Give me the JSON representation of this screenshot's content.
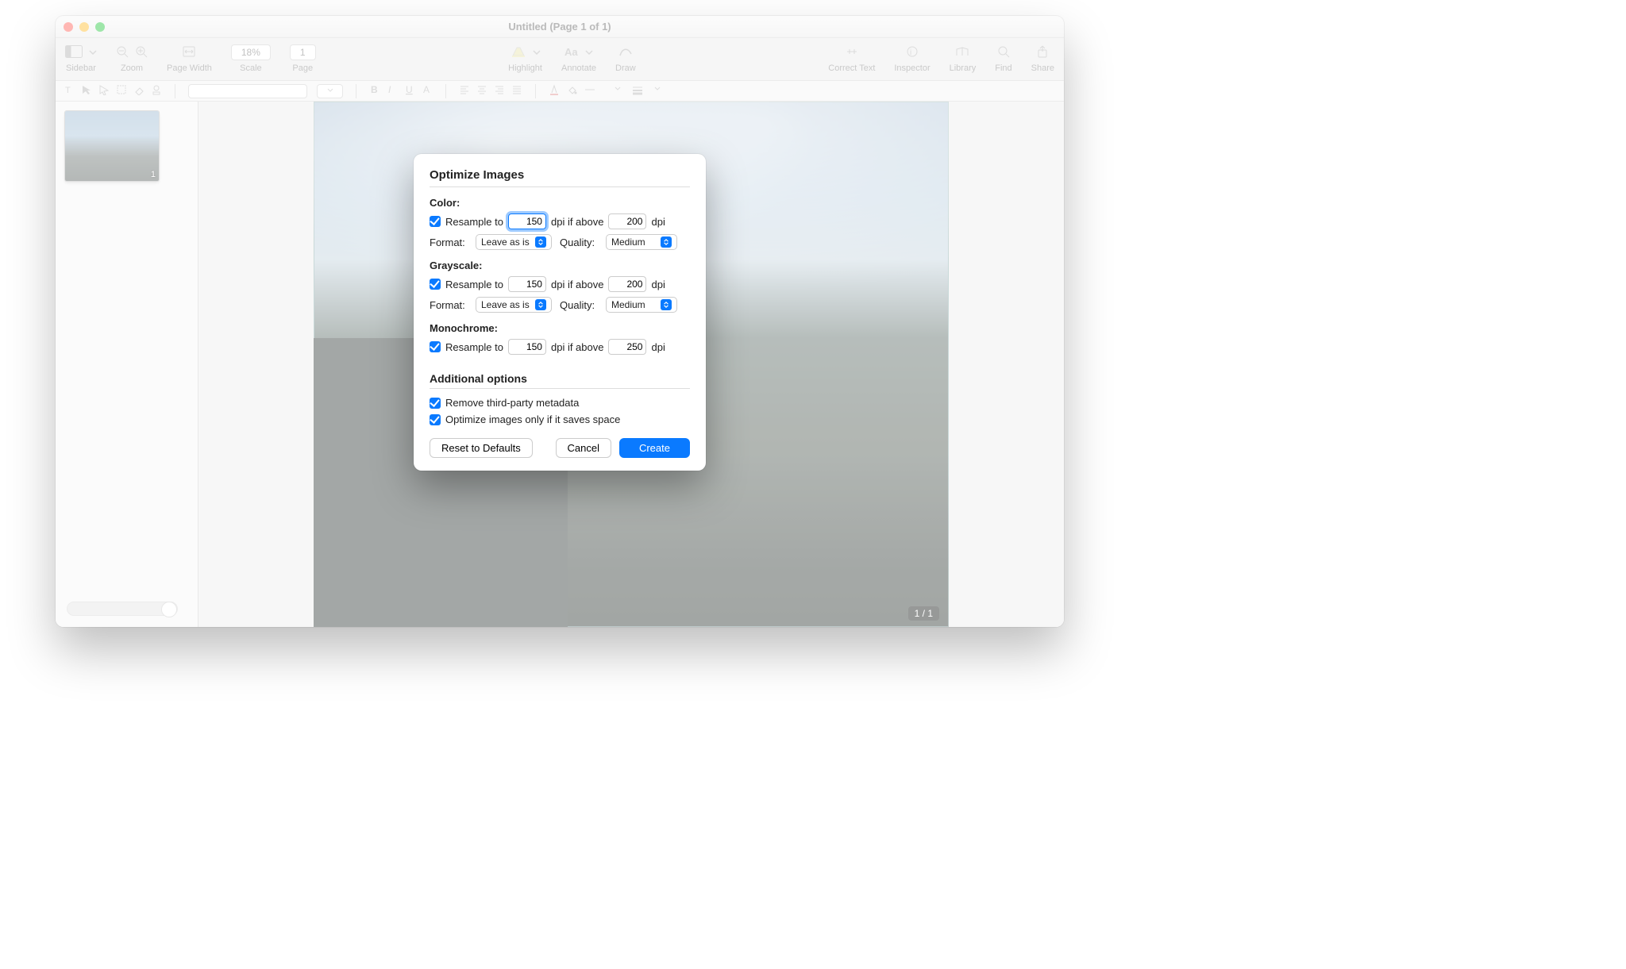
{
  "window": {
    "title": "Untitled (Page 1 of 1)"
  },
  "toolbar": {
    "sidebar_label": "Sidebar",
    "zoom_label": "Zoom",
    "page_width_label": "Page Width",
    "scale_value": "18%",
    "scale_label": "Scale",
    "page_value": "1",
    "page_label": "Page",
    "highlight_label": "Highlight",
    "annotate_label": "Annotate",
    "draw_label": "Draw",
    "correct_text_label": "Correct Text",
    "inspector_label": "Inspector",
    "library_label": "Library",
    "find_label": "Find",
    "share_label": "Share"
  },
  "sidebar": {
    "thumb_page": "1"
  },
  "canvas": {
    "page_indicator": "1 / 1"
  },
  "dialog": {
    "title": "Optimize Images",
    "color": {
      "heading": "Color:",
      "resample_label": "Resample to",
      "resample_value": "150",
      "resample_checked": true,
      "if_above_label": "dpi if above",
      "if_above_value": "200",
      "dpi_label": "dpi",
      "format_label": "Format:",
      "format_value": "Leave as is",
      "quality_label": "Quality:",
      "quality_value": "Medium"
    },
    "grayscale": {
      "heading": "Grayscale:",
      "resample_label": "Resample to",
      "resample_value": "150",
      "resample_checked": true,
      "if_above_label": "dpi if above",
      "if_above_value": "200",
      "dpi_label": "dpi",
      "format_label": "Format:",
      "format_value": "Leave as is",
      "quality_label": "Quality:",
      "quality_value": "Medium"
    },
    "mono": {
      "heading": "Monochrome:",
      "resample_label": "Resample to",
      "resample_value": "150",
      "resample_checked": true,
      "if_above_label": "dpi if above",
      "if_above_value": "250",
      "dpi_label": "dpi"
    },
    "additional": {
      "heading": "Additional options",
      "remove_metadata": "Remove third-party metadata",
      "optimize_space": "Optimize images only if it saves space"
    },
    "buttons": {
      "reset": "Reset to Defaults",
      "cancel": "Cancel",
      "create": "Create"
    }
  }
}
